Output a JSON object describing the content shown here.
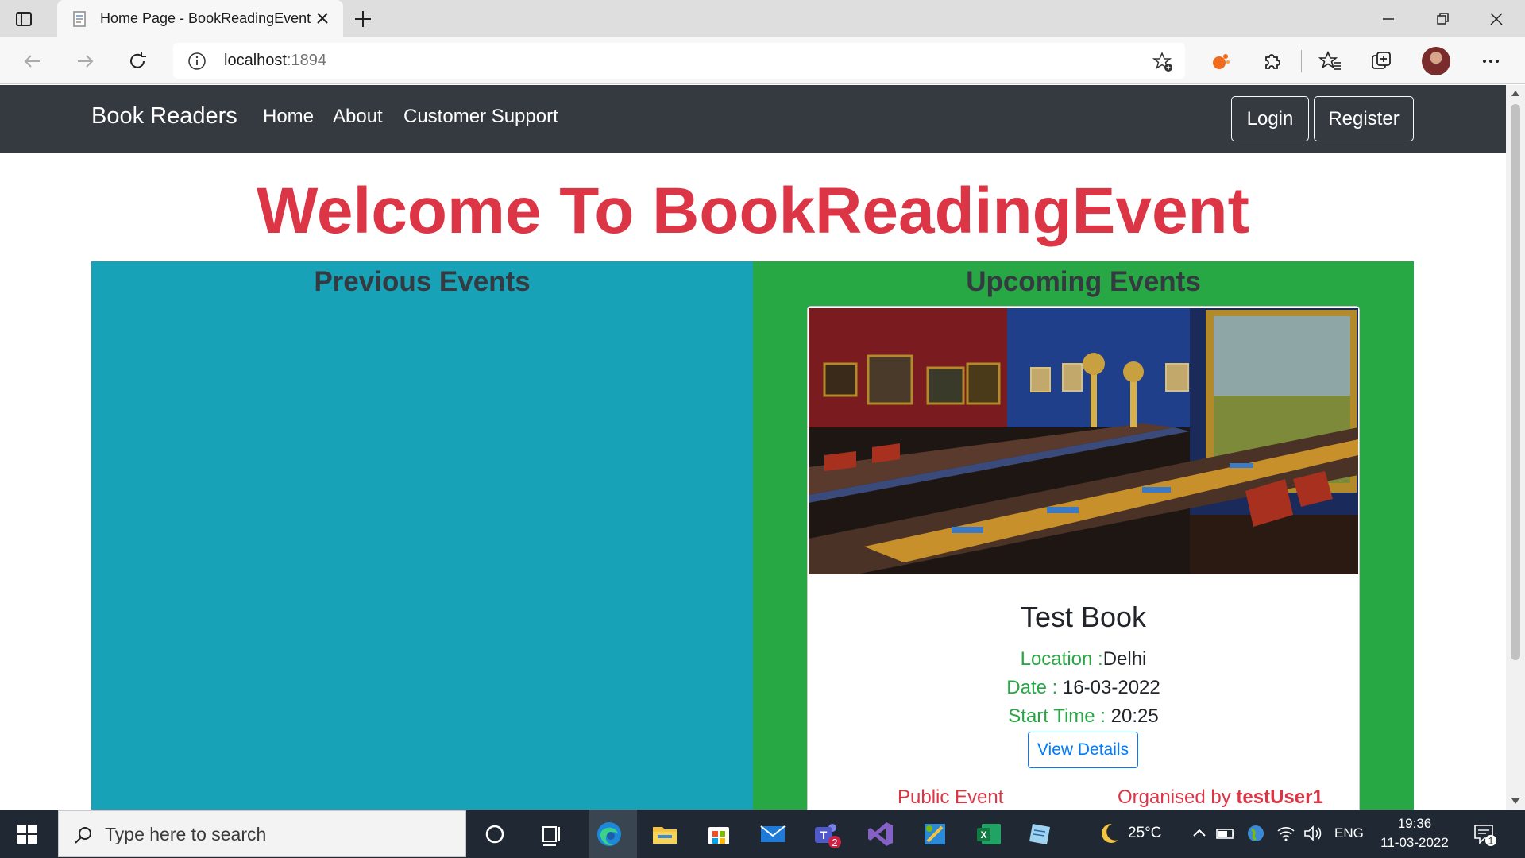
{
  "browser": {
    "tab_title": "Home Page - BookReadingEvent",
    "address_host": "localhost",
    "address_port": ":1894"
  },
  "navbar": {
    "brand": "Book Readers",
    "links": [
      "Home",
      "About",
      "Customer Support"
    ],
    "login": "Login",
    "register": "Register"
  },
  "page": {
    "welcome": "Welcome To BookReadingEvent",
    "previous_title": "Previous Events",
    "upcoming_title": "Upcoming Events"
  },
  "event_card": {
    "title": "Test Book",
    "location_label": "Location :",
    "location": "Delhi",
    "date_label": "Date : ",
    "date": "16-03-2022",
    "time_label": "Start Time : ",
    "time": "20:25",
    "view_button": "View Details",
    "visibility": "Public Event",
    "organised_label": "Organised by ",
    "organiser": "testUser1"
  },
  "taskbar": {
    "search_placeholder": "Type here to search",
    "weather": "25°C",
    "language": "ENG",
    "time": "19:36",
    "date": "11-03-2022",
    "teams_badge": "2",
    "notification_badge": "1"
  },
  "colors": {
    "navbar": "#343a40",
    "welcome": "#dc3545",
    "previous_bg": "#17a2b8",
    "upcoming_bg": "#28a745",
    "primary": "#007bff"
  }
}
